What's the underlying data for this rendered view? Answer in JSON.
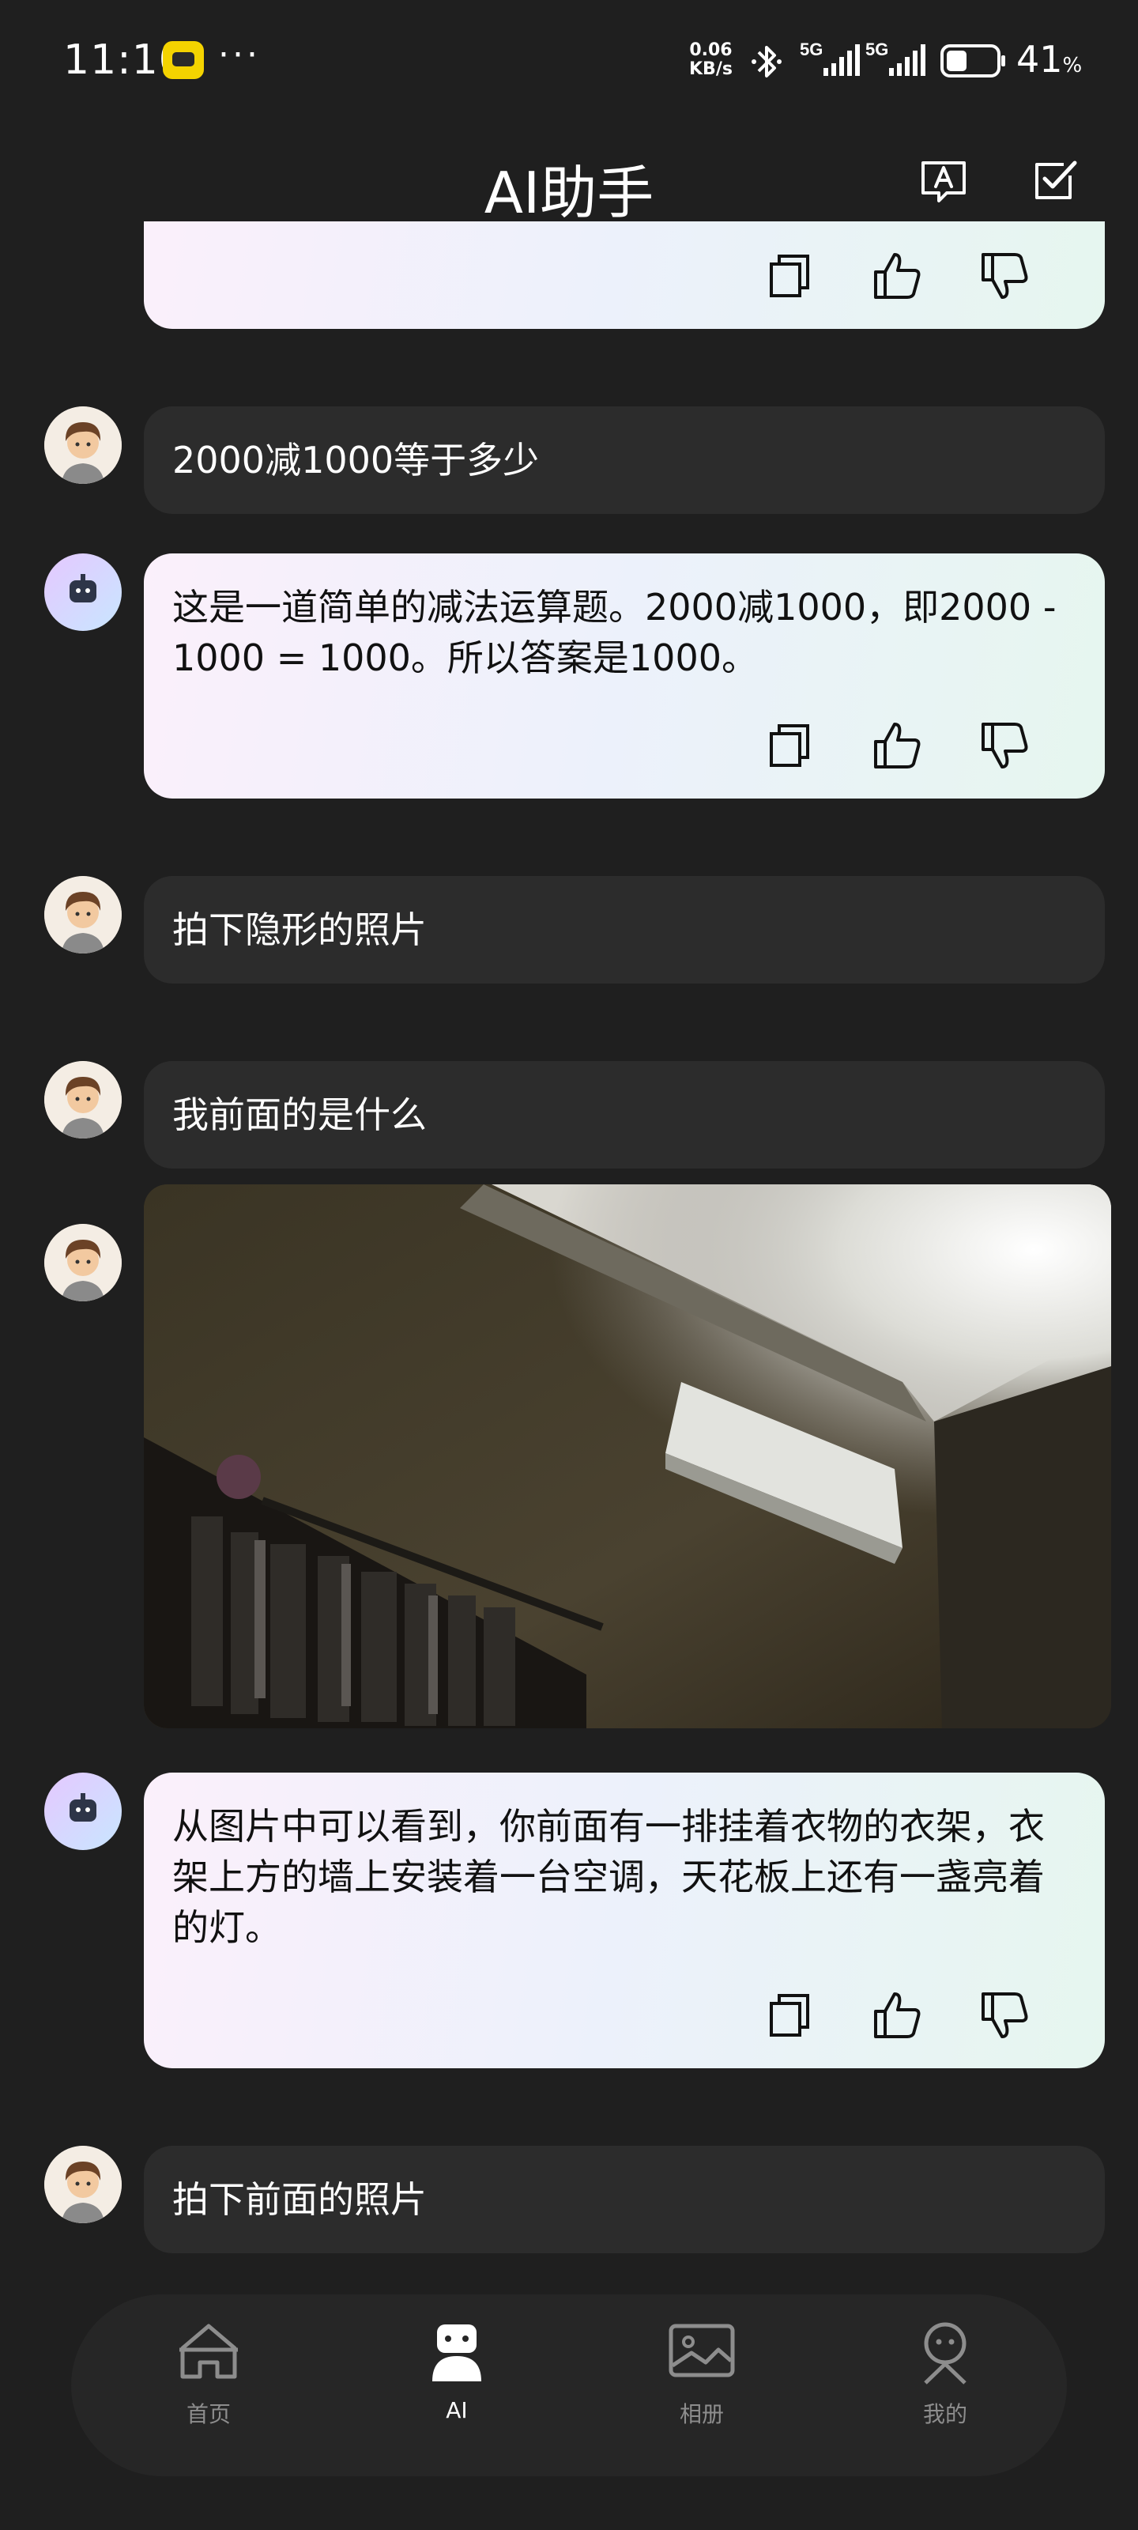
{
  "status_bar": {
    "time": "11:10",
    "net_speed_value": "0.06",
    "net_speed_unit": "KB/s",
    "signal_1": "5G",
    "signal_2": "5G",
    "battery_number": "41",
    "battery_unit": "%",
    "battery_level": 0.41
  },
  "header": {
    "title": "AI助手",
    "translate_icon": "translate-icon",
    "check_icon": "checkbox-icon"
  },
  "messages": [
    {
      "role": "assistant",
      "text": "",
      "partial": true
    },
    {
      "role": "user",
      "text": "2000减1000等于多少"
    },
    {
      "role": "assistant",
      "text": "这是一道简单的减法运算题。2000减1000，即2000 - 1000 = 1000。所以答案是1000。"
    },
    {
      "role": "user",
      "text": "拍下隐形的照片"
    },
    {
      "role": "user",
      "text": "我前面的是什么"
    },
    {
      "role": "user",
      "type": "image",
      "alt": "photo"
    },
    {
      "role": "assistant",
      "text": "从图片中可以看到，你前面有一排挂着衣物的衣架，衣架上方的墙上安装着一台空调，天花板上还有一盏亮着的灯。"
    },
    {
      "role": "user",
      "text": "拍下前面的照片"
    }
  ],
  "nav": {
    "items": [
      {
        "label": "首页",
        "icon": "home-icon",
        "active": false
      },
      {
        "label": "AI",
        "icon": "robot-icon",
        "active": true
      },
      {
        "label": "相册",
        "icon": "gallery-icon",
        "active": false
      },
      {
        "label": "我的",
        "icon": "profile-icon",
        "active": false
      }
    ]
  },
  "colors": {
    "background": "#1f1f1f",
    "user_bubble": "#2c2c2c",
    "ai_bubble_gradient": [
      "#fbf0fb",
      "#ecf1fb",
      "#e6f6ef"
    ],
    "nav_bar": "#262626"
  }
}
